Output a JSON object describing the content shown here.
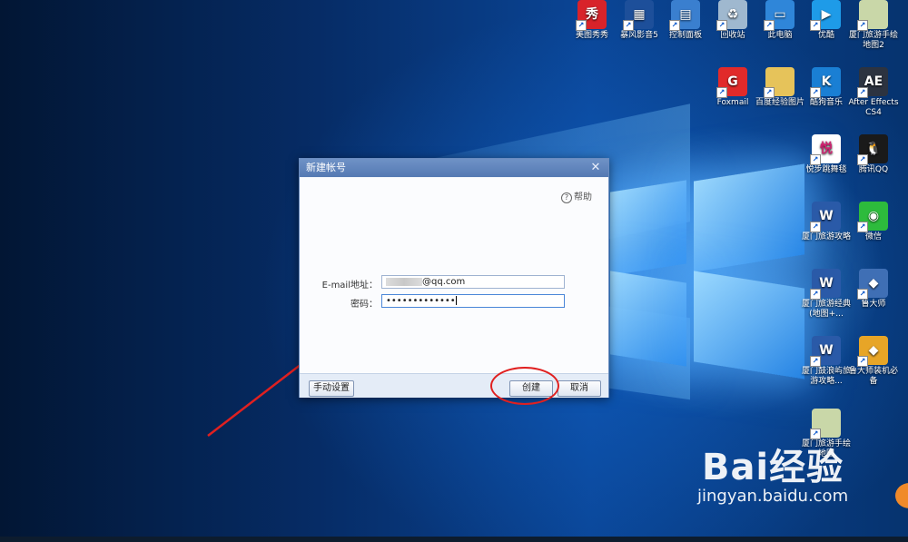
{
  "desktop_icons": [
    {
      "id": "meitu",
      "label": "美图秀秀",
      "icon": "meitu-icon",
      "color": "#d8232a",
      "glyph": "秀"
    },
    {
      "id": "storm",
      "label": "暴风影音5",
      "icon": "storm-player-icon",
      "color": "#1d4f9a",
      "glyph": "▦"
    },
    {
      "id": "control",
      "label": "控制面板",
      "icon": "control-panel-icon",
      "color": "#3a7fcf",
      "glyph": "▤"
    },
    {
      "id": "recycle",
      "label": "回收站",
      "icon": "recycle-bin-icon",
      "color": "#9fb8cf",
      "glyph": "♻"
    },
    {
      "id": "pc",
      "label": "此电脑",
      "icon": "computer-icon",
      "color": "#2f86d9",
      "glyph": "▭"
    },
    {
      "id": "youku",
      "label": "优酷",
      "icon": "youku-icon",
      "color": "#1e9be8",
      "glyph": "▶"
    },
    {
      "id": "map2",
      "label": "厦门旅游手绘地图2",
      "icon": "map-image-icon",
      "color": "#c9d7a8",
      "glyph": ""
    },
    {
      "id": "foxmail",
      "label": "Foxmail",
      "icon": "foxmail-icon",
      "color": "#e12a2a",
      "glyph": "G"
    },
    {
      "id": "baidu-folder",
      "label": "百度经验图片",
      "icon": "folder-icon",
      "color": "#e6c35a",
      "glyph": ""
    },
    {
      "id": "kugou",
      "label": "酷狗音乐",
      "icon": "kugou-icon",
      "color": "#1a7fd4",
      "glyph": "K"
    },
    {
      "id": "ae",
      "label": "After Effects CS4",
      "icon": "after-effects-icon",
      "color": "#2c3340",
      "glyph": "AE"
    },
    {
      "id": "yuebu",
      "label": "悦步跳舞毯",
      "icon": "yuebu-icon",
      "color": "#ffffff",
      "glyph": "悦"
    },
    {
      "id": "qq",
      "label": "腾讯QQ",
      "icon": "qq-icon",
      "color": "#1a1a1a",
      "glyph": "🐧"
    },
    {
      "id": "doc1",
      "label": "厦门旅游攻略",
      "icon": "word-doc-icon",
      "color": "#2a5aa8",
      "glyph": "W"
    },
    {
      "id": "wechat",
      "label": "微信",
      "icon": "wechat-icon",
      "color": "#2dbb3c",
      "glyph": "◉"
    },
    {
      "id": "doc2",
      "label": "厦门旅游经典(地图+...",
      "icon": "word-doc-icon",
      "color": "#2a5aa8",
      "glyph": "W"
    },
    {
      "id": "ludashi",
      "label": "鲁大师",
      "icon": "ludashi-icon",
      "color": "#3f6fb5",
      "glyph": "◆"
    },
    {
      "id": "doc3",
      "label": "厦门鼓浪屿旅游攻略...",
      "icon": "word-doc-icon",
      "color": "#2a5aa8",
      "glyph": "W"
    },
    {
      "id": "ludashi-bi",
      "label": "鲁大师装机必备",
      "icon": "ludashi-install-icon",
      "color": "#e7a527",
      "glyph": "◆"
    },
    {
      "id": "map1",
      "label": "厦门旅游手绘地图",
      "icon": "map-image-icon",
      "color": "#c9d7a8",
      "glyph": ""
    }
  ],
  "dialog": {
    "title": "新建帐号",
    "close_glyph": "✕",
    "help_label": "帮助",
    "help_glyph": "?",
    "email_label": "E-mail地址：",
    "email_value": "@qq.com",
    "password_label": "密码：",
    "password_value": "•••••••••••••",
    "manual_button": "手动设置",
    "create_button": "创建",
    "cancel_button": "取消"
  },
  "watermark": {
    "brand": "Bai经验",
    "url": "jingyan.baidu.com"
  },
  "annotation_color": "#e02020"
}
